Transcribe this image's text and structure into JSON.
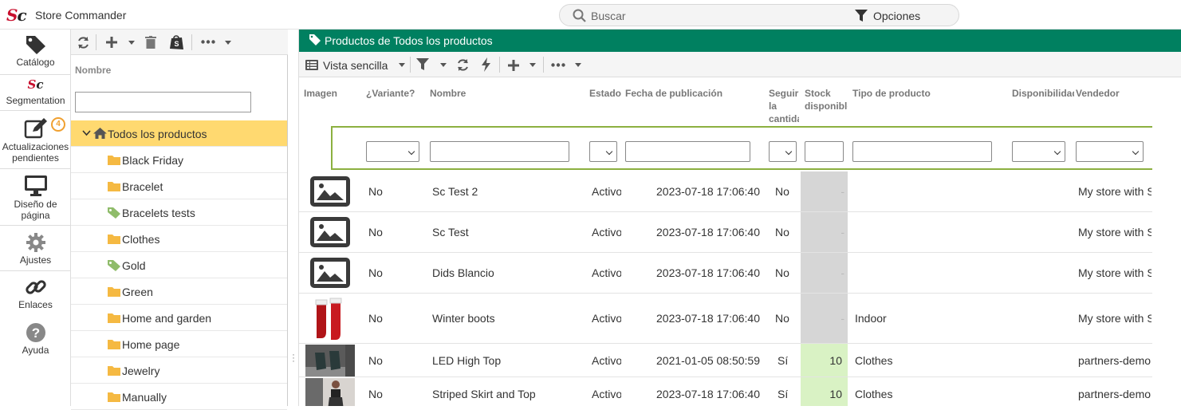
{
  "app": {
    "title": "Store Commander",
    "logo": "Sc"
  },
  "search": {
    "placeholder": "Buscar",
    "options_label": "Opciones"
  },
  "nav": [
    {
      "label": "Catálogo",
      "icon": "tag-icon"
    },
    {
      "label": "Segmentation",
      "icon": "sc-logo-icon"
    },
    {
      "label": "Actualizaciones pendientes",
      "icon": "edit-icon",
      "badge": "4"
    },
    {
      "label": "Diseño de página",
      "icon": "monitor-icon"
    },
    {
      "label": "Ajustes",
      "icon": "gear-icon"
    },
    {
      "label": "Enlaces",
      "icon": "link-icon"
    },
    {
      "label": "Ayuda",
      "icon": "help-icon"
    }
  ],
  "categories": {
    "header": "Nombre",
    "filter_value": "",
    "items": [
      {
        "label": "Todos los productos",
        "icon": "home-icon",
        "selected": true
      },
      {
        "label": "Black Friday",
        "icon": "folder-icon"
      },
      {
        "label": "Bracelet",
        "icon": "folder-icon"
      },
      {
        "label": "Bracelets tests",
        "icon": "tag-green-icon"
      },
      {
        "label": "Clothes",
        "icon": "folder-icon"
      },
      {
        "label": "Gold",
        "icon": "tag-green-icon"
      },
      {
        "label": "Green",
        "icon": "folder-icon"
      },
      {
        "label": "Home and garden",
        "icon": "folder-icon"
      },
      {
        "label": "Home page",
        "icon": "folder-icon"
      },
      {
        "label": "Jewelry",
        "icon": "folder-icon"
      },
      {
        "label": "Manually",
        "icon": "folder-icon"
      }
    ]
  },
  "products": {
    "title": "Productos de Todos los productos",
    "view_label": "Vista sencilla",
    "columns": {
      "imagen": "Imagen",
      "variante": "¿Variante?",
      "nombre": "Nombre",
      "estado": "Estado",
      "fecha": "Fecha de publicación",
      "seguir": "Seguir la cantidad",
      "stock": "Stock disponible",
      "tipo": "Tipo de producto",
      "disponibilidad": "Disponibilidad",
      "vendedor": "Vendedor"
    },
    "rows": [
      {
        "image": "placeholder",
        "variante": "No",
        "nombre": "Sc Test 2",
        "estado": "Activo",
        "fecha": "2023-07-18 17:06:40",
        "seguir": "No",
        "stock": "-",
        "tipo": "",
        "vendedor": "My store with Shopify"
      },
      {
        "image": "placeholder",
        "variante": "No",
        "nombre": "Sc Test",
        "estado": "Activo",
        "fecha": "2023-07-18 17:06:40",
        "seguir": "No",
        "stock": "-",
        "tipo": "",
        "vendedor": "My store with Shopify"
      },
      {
        "image": "placeholder",
        "variante": "No",
        "nombre": "Dids Blancio",
        "estado": "Activo",
        "fecha": "2023-07-18 17:06:40",
        "seguir": "No",
        "stock": "-",
        "tipo": "",
        "vendedor": "My store with Shopify"
      },
      {
        "image": "boots",
        "variante": "No",
        "nombre": "Winter boots",
        "estado": "Activo",
        "fecha": "2023-07-18 17:06:40",
        "seguir": "No",
        "stock": "-",
        "tipo": "Indoor",
        "vendedor": "My store with Shopify"
      },
      {
        "image": "shoes-photo",
        "variante": "No",
        "nombre": "LED High Top",
        "estado": "Activo",
        "fecha": "2021-01-05 08:50:59",
        "seguir": "Sí",
        "stock": "10",
        "tipo": "Clothes",
        "vendedor": "partners-demo"
      },
      {
        "image": "skirt-photo",
        "variante": "No",
        "nombre": "Striped Skirt and Top",
        "estado": "Activo",
        "fecha": "2023-07-18 17:06:40",
        "seguir": "Sí",
        "stock": "10",
        "tipo": "Clothes",
        "vendedor": "partners-demo"
      }
    ]
  },
  "colors": {
    "header_green": "#008060",
    "selected_row": "#ffd970",
    "stock_gray": "#d6d6d6",
    "stock_green": "#d9f2c4",
    "filter_outline": "#8cb040",
    "folder": "#f5b942"
  }
}
